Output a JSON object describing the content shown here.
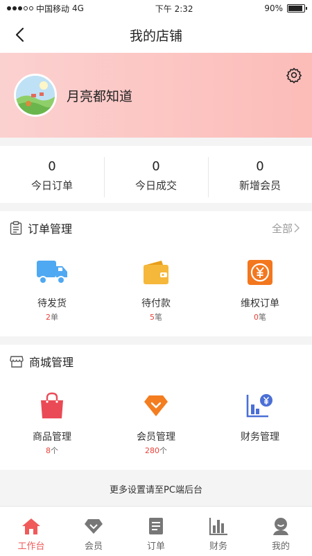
{
  "status_bar": {
    "carrier": "中国移动",
    "network": "4G",
    "time": "下午 2:32",
    "battery": "90%",
    "battery_level": 0.9
  },
  "nav": {
    "title": "我的店铺",
    "back_icon": "chevron-left-icon"
  },
  "profile": {
    "name": "月亮都知道",
    "settings_icon": "gear-icon"
  },
  "stats": [
    {
      "value": "0",
      "label": "今日订单"
    },
    {
      "value": "0",
      "label": "今日成交"
    },
    {
      "value": "0",
      "label": "新增会员"
    }
  ],
  "orders": {
    "title": "订单管理",
    "more": "全部",
    "items": [
      {
        "label": "待发货",
        "count": "2",
        "unit": "单",
        "icon": "truck-icon",
        "color": "#4fa8f2"
      },
      {
        "label": "待付款",
        "count": "5",
        "unit": "笔",
        "icon": "wallet-icon",
        "color": "#f5b83a"
      },
      {
        "label": "维权订单",
        "count": "0",
        "unit": "笔",
        "icon": "refund-yen-icon",
        "color": "#f3771e"
      }
    ]
  },
  "mall": {
    "title": "商城管理",
    "items": [
      {
        "label": "商品管理",
        "count": "8",
        "unit": "个",
        "icon": "shopping-bag-icon",
        "color": "#ea4a55"
      },
      {
        "label": "会员管理",
        "count": "280",
        "unit": "个",
        "icon": "member-diamond-icon",
        "color": "#f47d1f"
      },
      {
        "label": "财务管理",
        "icon": "finance-chart-icon",
        "color": "#4b6fd6"
      }
    ]
  },
  "footer_note": "更多设置请至PC端后台",
  "tabs": [
    {
      "label": "工作台",
      "icon": "home-icon",
      "active": true
    },
    {
      "label": "会员",
      "icon": "diamond-icon"
    },
    {
      "label": "订单",
      "icon": "document-icon"
    },
    {
      "label": "财务",
      "icon": "bar-chart-icon"
    },
    {
      "label": "我的",
      "icon": "user-icon"
    }
  ],
  "colors": {
    "accent": "#f05a5a",
    "count_red": "#e8413a",
    "banner": "#fcbcb8"
  }
}
